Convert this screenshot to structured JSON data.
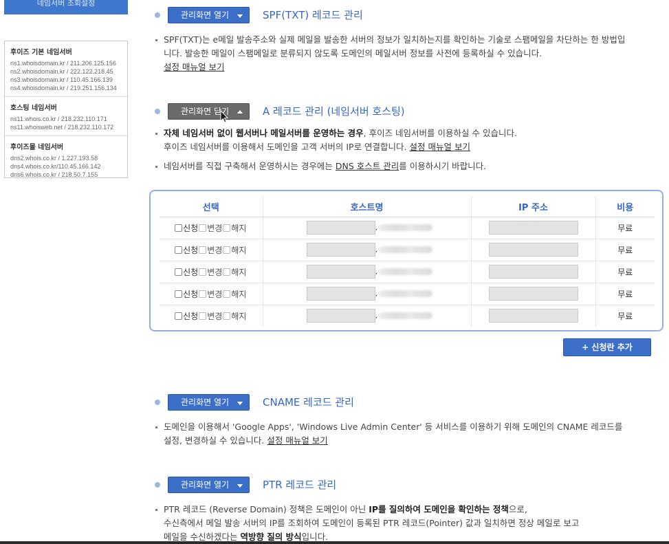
{
  "sidebar": {
    "top_label": "네임서버 조회설정",
    "groups": [
      {
        "title": "후이즈 기본 네임서버",
        "lines": [
          "ns1.whoisdomain.kr / 211.206.125.156",
          "ns2.whoisdomain.kr / 222.122.218.45",
          "ns3.whoisdomain.kr / 110.45.166.139",
          "ns4.whoisdomain.kr / 219.251.156.134"
        ]
      },
      {
        "title": "호스팅 네임서버",
        "lines": [
          "ns11.whois.co.kr / 218.232.110.171",
          "ns11.whoisweb.net / 218.232.110.172"
        ]
      },
      {
        "title": "후이즈몰 네임서버",
        "lines": [
          "dns2.whois.co.kr / 1.227.193.58",
          "dns4.whois.co.kr/110.45.166.142",
          "dns6.whois.co.kr / 218.50.7.155"
        ]
      }
    ]
  },
  "sections": {
    "spf": {
      "button": "관리화면 열기",
      "title": "SPF(TXT) 레코드 관리",
      "desc": "SPF(TXT)는 e메일 발송주소와 실제 메일을 발송한 서버의 정보가 일치하는지를 확인하는 기술로 스팸메일을 차단하는 한 방법입니다. 발송한 메일이 스팸메일로 분류되지 않도록 도메인의 메일서버 정보를 사전에 등록하실 수 있습니다.",
      "link": "설정 매뉴얼 보기"
    },
    "a": {
      "button": "관리화면 닫기",
      "title": "A 레코드 관리 (네임서버 호스팅)",
      "desc1_strong": "자체 네임서버 없이 웹서버나 메일서버를 운영하는 경우",
      "desc1_rest": ", 후이즈 네임서버를 이용하실 수 있습니다.",
      "desc1_line2": "후이즈 네임서버를 이용해서 도메인을 고객 서버의 IP로 연결합니다.",
      "desc1_link": "설정 매뉴얼 보기",
      "desc2_pre": "네임서버를 직접 구축해서 운영하시는 경우에는 ",
      "desc2_link": "DNS 호스트 관리",
      "desc2_post": "를 이용하시기 바랍니다."
    },
    "cname": {
      "button": "관리화면 열기",
      "title": "CNAME 레코드 관리",
      "desc": "도메인을 이용해서 'Google Apps', 'Windows Live Admin Center' 등 서비스를 이용하기 위해 도메인의 CNAME 레코드를 설정, 변경하실 수 있습니다.",
      "link": "설정 매뉴얼 보기"
    },
    "ptr": {
      "button": "관리화면 열기",
      "title": "PTR 레코드 관리",
      "desc_a": "PTR 레코드 (Reverse Domain) 정책은 도메인이 아닌 ",
      "desc_b": "IP를 질의하여 도메인을 확인하는 정책",
      "desc_c": "으로,",
      "desc_line2": "수신측에서 메일 발송 서버의 IP를 조회하여 도메인이 등록된 PTR 레코드(Pointer) 값과 일치하면 정상 메일로 보고",
      "desc_line3_a": "메일을 수신하겠다는 ",
      "desc_line3_b": "역방향 질의 방식",
      "desc_line3_c": "입니다."
    }
  },
  "table": {
    "headers": [
      "선택",
      "호스트명",
      "IP 주소",
      "비용"
    ],
    "options": [
      "신청",
      "변경",
      "해지"
    ],
    "dot": ".",
    "rows": [
      {
        "fee": "무료"
      },
      {
        "fee": "무료"
      },
      {
        "fee": "무료"
      },
      {
        "fee": "무료"
      },
      {
        "fee": "무료"
      }
    ]
  },
  "add_row_button": "+ 신청란 추가"
}
